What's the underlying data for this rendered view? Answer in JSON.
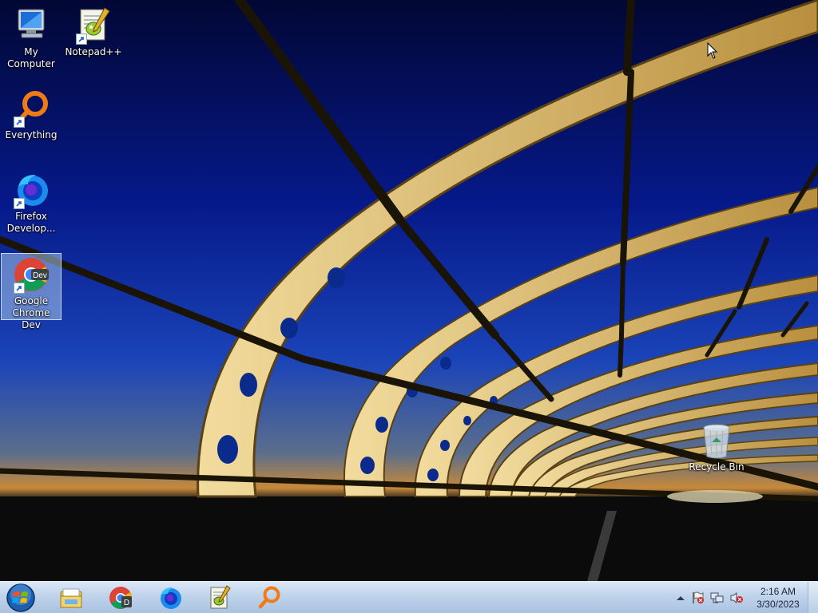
{
  "desktop_icons": [
    {
      "label": "My Computer",
      "icon": "my-computer-icon"
    },
    {
      "label": "Notepad++",
      "icon": "notepad-plus-plus-icon",
      "shortcut": true
    },
    {
      "label": "Everything",
      "icon": "everything-search-icon",
      "shortcut": true
    },
    {
      "label": "Firefox Develop...",
      "icon": "firefox-developer-icon",
      "shortcut": true
    },
    {
      "label": "Google Chrome Dev",
      "icon": "chrome-dev-icon",
      "shortcut": true,
      "selected": true
    },
    {
      "label": "Recycle Bin",
      "icon": "recycle-bin-icon"
    }
  ],
  "taskbar": {
    "start_button": {
      "icon": "windows-start-orb-icon"
    },
    "pinned": [
      {
        "name": "Windows Explorer",
        "icon": "folder-explorer-icon"
      },
      {
        "name": "Google Chrome Dev",
        "icon": "chrome-dev-icon"
      },
      {
        "name": "Firefox Developer Edition",
        "icon": "firefox-developer-icon"
      },
      {
        "name": "Notepad++",
        "icon": "notepad-plus-plus-icon"
      },
      {
        "name": "Everything",
        "icon": "everything-search-icon"
      }
    ],
    "tray": {
      "icons": [
        "show-hidden-icons-arrow-icon",
        "action-center-flag-icon",
        "network-icon",
        "volume-muted-icon"
      ],
      "time": "2:16 AM",
      "date": "3/30/2023"
    }
  },
  "colors": {
    "sky_top": "#030a4a",
    "sky_mid": "#0a2a9a",
    "horizon": "#c58a3c",
    "arch": "#e8c77a",
    "taskbar": "#bfd3ea",
    "selection": "#aac8eb"
  }
}
